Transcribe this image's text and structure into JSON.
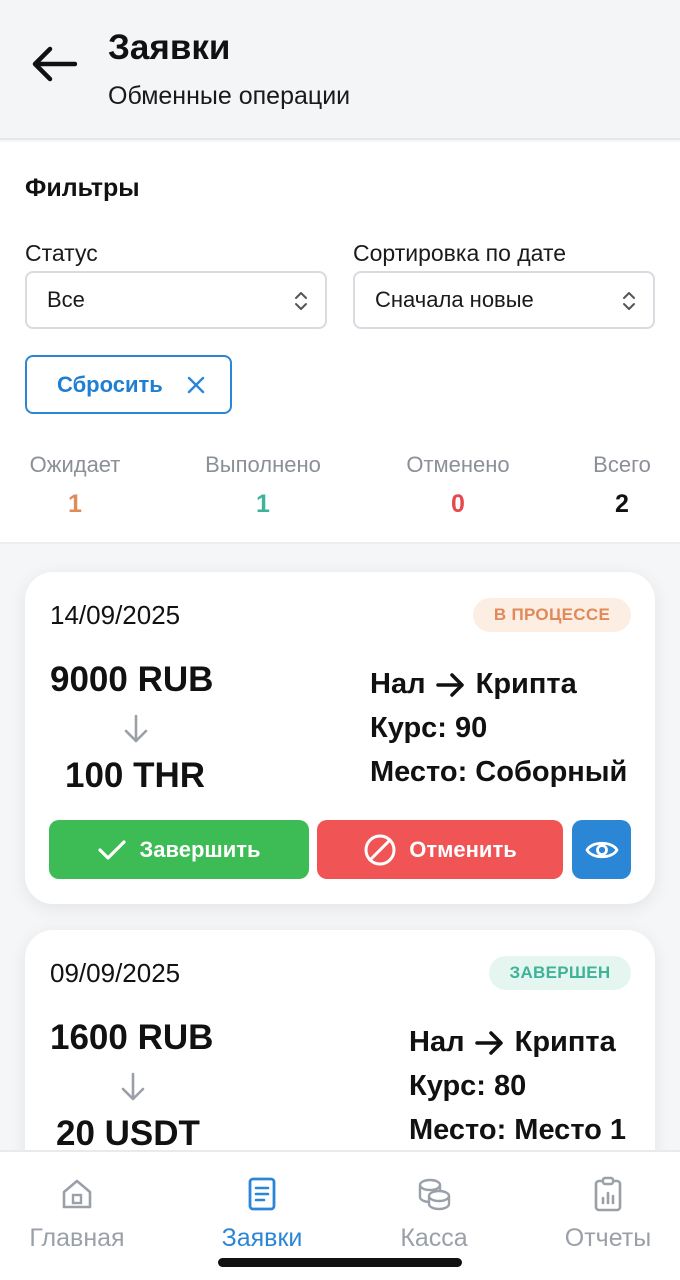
{
  "header": {
    "title": "Заявки",
    "subtitle": "Обменные операции"
  },
  "filters": {
    "title": "Фильтры",
    "status_label": "Статус",
    "status_value": "Все",
    "sort_label": "Сортировка по дате",
    "sort_value": "Сначала новые",
    "reset_label": "Сбросить"
  },
  "stats": [
    {
      "label": "Ожидает",
      "value": "1",
      "color": "#e08a5a"
    },
    {
      "label": "Выполнено",
      "value": "1",
      "color": "#3fb39a"
    },
    {
      "label": "Отменено",
      "value": "0",
      "color": "#e5484d"
    },
    {
      "label": "Всего",
      "value": "2",
      "color": "#111111"
    }
  ],
  "orders": [
    {
      "date": "14/09/2025",
      "status": "В ПРОЦЕССЕ",
      "status_color": "#e08a5a",
      "status_bg": "#fdeee3",
      "from_amount": "9000 RUB",
      "to_amount": "100 THR",
      "direction_from": "Нал",
      "direction_to": "Крипта",
      "rate": "Курс: 90",
      "place": "Место: Соборный",
      "complete_label": "Завершить",
      "cancel_label": "Отменить"
    },
    {
      "date": "09/09/2025",
      "status": "ЗАВЕРШЕН",
      "status_color": "#3fb39a",
      "status_bg": "#e4f6ef",
      "from_amount": "1600 RUB",
      "to_amount": "20 USDT",
      "direction_from": "Нал",
      "direction_to": "Крипта",
      "rate": "Курс: 80",
      "place": "Место: Место 1"
    }
  ],
  "colors": {
    "accent": "#2b86d6",
    "success": "#3dbb55",
    "danger": "#f05454",
    "view": "#2b86d6"
  },
  "nav": [
    {
      "label": "Главная",
      "icon": "home-icon"
    },
    {
      "label": "Заявки",
      "icon": "document-icon",
      "active": true
    },
    {
      "label": "Касса",
      "icon": "coins-icon"
    },
    {
      "label": "Отчеты",
      "icon": "clipboard-chart-icon"
    }
  ]
}
